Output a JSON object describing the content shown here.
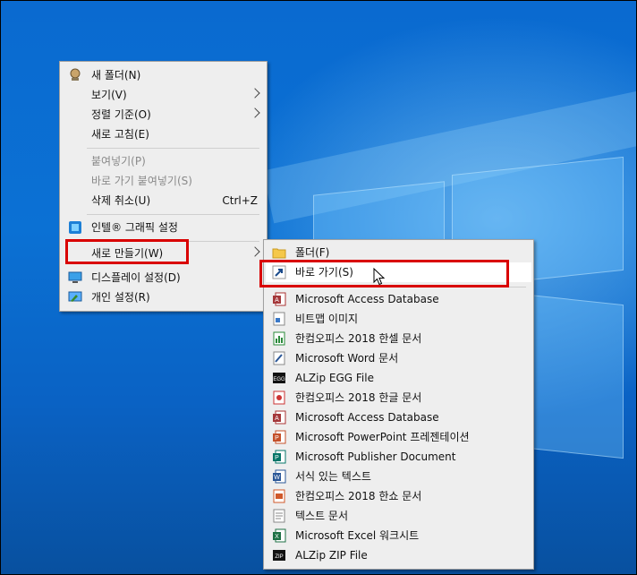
{
  "context_menu": {
    "items": [
      {
        "label": "새 폴더(N)"
      },
      {
        "label": "보기(V)"
      },
      {
        "label": "정렬 기준(O)"
      },
      {
        "label": "새로 고침(E)"
      },
      {
        "label": "붙여넣기(P)"
      },
      {
        "label": "바로 가기 붙여넣기(S)"
      },
      {
        "label": "삭제 취소(U)",
        "shortcut": "Ctrl+Z"
      },
      {
        "label": "인텔® 그래픽 설정"
      },
      {
        "label": "새로 만들기(W)"
      },
      {
        "label": "디스플레이 설정(D)"
      },
      {
        "label": "개인 설정(R)"
      }
    ]
  },
  "submenu": {
    "items": [
      {
        "label": "폴더(F)",
        "icon": "folder-icon"
      },
      {
        "label": "바로 가기(S)",
        "icon": "shortcut-icon"
      },
      {
        "label": "Microsoft Access Database",
        "icon": "access-icon"
      },
      {
        "label": "비트맵 이미지",
        "icon": "bitmap-icon"
      },
      {
        "label": "한컴오피스 2018 한셀 문서",
        "icon": "hancell-icon"
      },
      {
        "label": "Microsoft Word 문서",
        "icon": "word-doc-icon"
      },
      {
        "label": "ALZip EGG File",
        "icon": "egg-file-icon"
      },
      {
        "label": "한컴오피스 2018 한글 문서",
        "icon": "hwp-icon"
      },
      {
        "label": "Microsoft Access Database",
        "icon": "access-icon"
      },
      {
        "label": "Microsoft PowerPoint 프레젠테이션",
        "icon": "powerpoint-icon"
      },
      {
        "label": "Microsoft Publisher Document",
        "icon": "publisher-icon"
      },
      {
        "label": "서식 있는 텍스트",
        "icon": "rtf-icon"
      },
      {
        "label": "한컴오피스 2018 한쇼 문서",
        "icon": "hanshow-icon"
      },
      {
        "label": "텍스트 문서",
        "icon": "text-doc-icon"
      },
      {
        "label": "Microsoft Excel 워크시트",
        "icon": "excel-icon"
      },
      {
        "label": "ALZip ZIP File",
        "icon": "zip-file-icon"
      }
    ]
  },
  "colors": {
    "highlight_box": "#d90000",
    "menu_bg": "#eeeeee",
    "desktop": "#0a6ad0"
  }
}
